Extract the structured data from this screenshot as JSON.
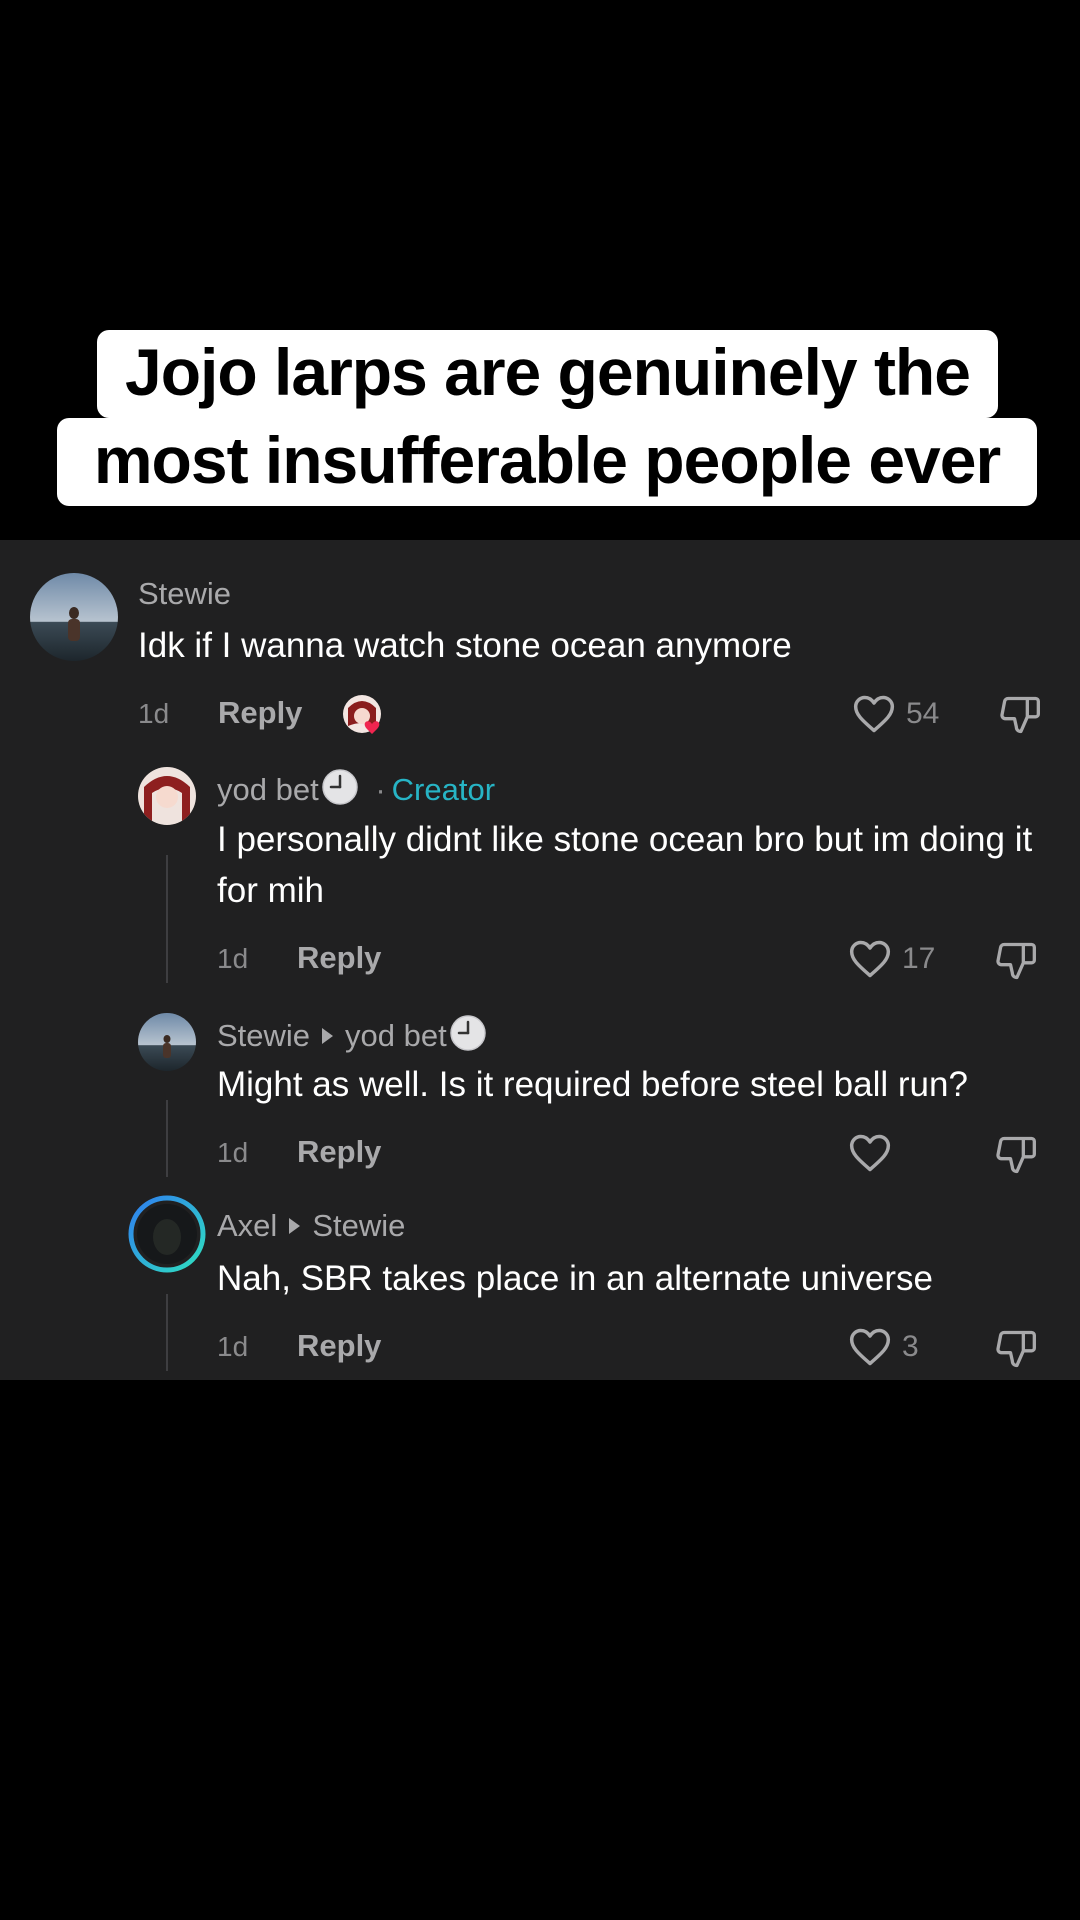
{
  "caption": {
    "line1": "Jojo larps are genuinely the",
    "line2": "most insufferable people ever"
  },
  "comments": [
    {
      "author": "Stewie",
      "text": "Idk if I wanna watch stone ocean anymore",
      "time": "1d",
      "reply_label": "Reply",
      "likes": "54",
      "creator_liked": true
    },
    {
      "author": "yod bet",
      "badge_separator": "·",
      "badge": "Creator",
      "text": "I personally didnt like stone ocean bro but im doing it for mih",
      "time": "1d",
      "reply_label": "Reply",
      "likes": "17"
    },
    {
      "author": "Stewie",
      "reply_to": "yod bet",
      "text": "Might as well. Is it required before steel ball run?",
      "time": "1d",
      "reply_label": "Reply",
      "likes": ""
    },
    {
      "author": "Axel",
      "reply_to": "Stewie",
      "text": "Nah, SBR takes place in an alternate universe",
      "time": "1d",
      "reply_label": "Reply",
      "likes": "3"
    }
  ],
  "colors": {
    "panel_bg": "#202021",
    "creator_accent": "#27b4c5",
    "liked_heart": "#f0254f"
  },
  "icons": [
    "heart-icon",
    "dislike-icon",
    "clock-emoji-icon",
    "creator-liked-badge-icon"
  ]
}
